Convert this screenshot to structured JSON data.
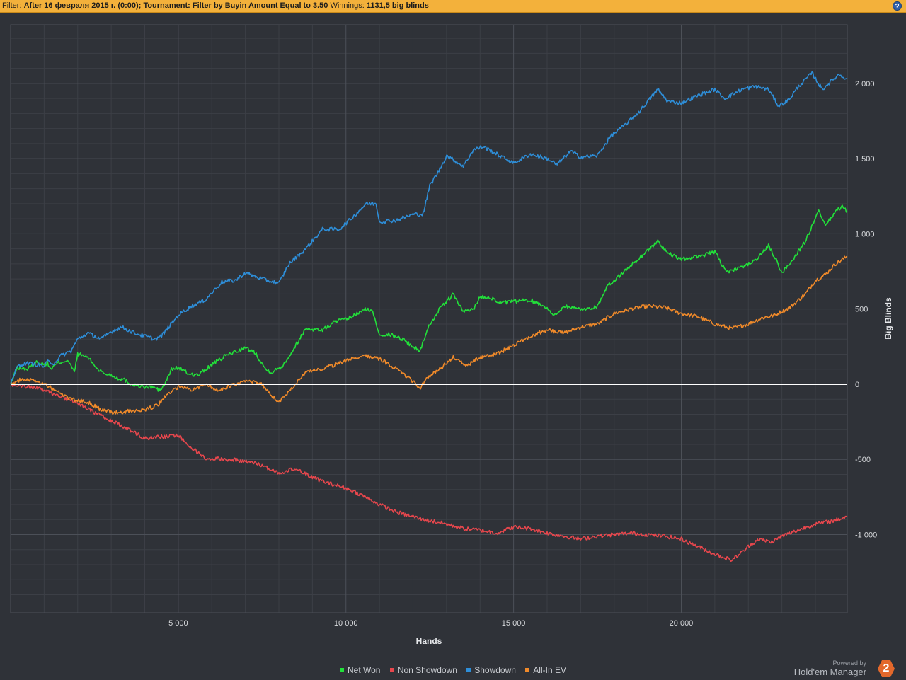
{
  "filter": {
    "label": "Filter:",
    "date_filter": "After 16 февраля 2015 г. (0:00);",
    "tournament_filter": "Tournament: Filter by Buyin Amount Equal to 3.50",
    "winnings_label": "Winnings:",
    "winnings_value": "1131,5 big blinds",
    "help_label": "?"
  },
  "brand": {
    "powered": "Powered by",
    "name": "Hold'em Manager",
    "logo_text": "2"
  },
  "colors": {
    "background": "#2f3238",
    "grid": "#4c5058",
    "zero_line": "#ffffff",
    "net_won": "#22e03a",
    "non_showdown": "#e8474d",
    "showdown": "#2e8ed8",
    "all_in_ev": "#f08a2a"
  },
  "chart_data": {
    "type": "line",
    "xlabel": "Hands",
    "ylabel": "Big Blinds",
    "xlim": [
      0,
      24950
    ],
    "ylim": [
      -1520,
      2390
    ],
    "x_ticks": [
      5000,
      10000,
      15000,
      20000
    ],
    "x_tick_labels": [
      "5 000",
      "10 000",
      "15 000",
      "20 000"
    ],
    "y_ticks": [
      2000,
      1500,
      1000,
      500,
      0,
      -500,
      -1000
    ],
    "y_tick_labels": [
      "2 000",
      "1 500",
      "1 000",
      "500",
      "0",
      "-500",
      "-1 000"
    ],
    "grid": true,
    "legend_position": "bottom",
    "series": [
      {
        "name": "Net Won",
        "color_key": "net_won",
        "points": [
          [
            0,
            0
          ],
          [
            200,
            110
          ],
          [
            500,
            100
          ],
          [
            800,
            150
          ],
          [
            1000,
            130
          ],
          [
            1100,
            140
          ],
          [
            1200,
            100
          ],
          [
            1400,
            140
          ],
          [
            1700,
            160
          ],
          [
            1900,
            80
          ],
          [
            2000,
            200
          ],
          [
            2300,
            180
          ],
          [
            2600,
            100
          ],
          [
            2800,
            70
          ],
          [
            3000,
            60
          ],
          [
            3200,
            40
          ],
          [
            3400,
            30
          ],
          [
            3600,
            0
          ],
          [
            3800,
            -10
          ],
          [
            4000,
            -20
          ],
          [
            4300,
            -20
          ],
          [
            4400,
            -40
          ],
          [
            4500,
            -30
          ],
          [
            4600,
            0
          ],
          [
            4800,
            100
          ],
          [
            5000,
            110
          ],
          [
            5300,
            70
          ],
          [
            5600,
            60
          ],
          [
            6000,
            130
          ],
          [
            6500,
            200
          ],
          [
            7000,
            240
          ],
          [
            7300,
            210
          ],
          [
            7600,
            100
          ],
          [
            7800,
            80
          ],
          [
            8100,
            120
          ],
          [
            8400,
            220
          ],
          [
            8800,
            370
          ],
          [
            9300,
            360
          ],
          [
            9700,
            420
          ],
          [
            10000,
            430
          ],
          [
            10600,
            500
          ],
          [
            10800,
            480
          ],
          [
            11000,
            330
          ],
          [
            11300,
            330
          ],
          [
            11700,
            300
          ],
          [
            12000,
            250
          ],
          [
            12200,
            220
          ],
          [
            12500,
            400
          ],
          [
            12800,
            500
          ],
          [
            13200,
            600
          ],
          [
            13500,
            480
          ],
          [
            13800,
            500
          ],
          [
            14000,
            580
          ],
          [
            14300,
            580
          ],
          [
            14600,
            540
          ],
          [
            15000,
            550
          ],
          [
            15500,
            560
          ],
          [
            16000,
            510
          ],
          [
            16200,
            450
          ],
          [
            16500,
            520
          ],
          [
            17000,
            500
          ],
          [
            17200,
            500
          ],
          [
            17500,
            520
          ],
          [
            17800,
            650
          ],
          [
            18300,
            750
          ],
          [
            18800,
            850
          ],
          [
            19300,
            950
          ],
          [
            19600,
            870
          ],
          [
            20000,
            830
          ],
          [
            20500,
            850
          ],
          [
            21000,
            880
          ],
          [
            21200,
            800
          ],
          [
            21400,
            740
          ],
          [
            21800,
            780
          ],
          [
            22200,
            820
          ],
          [
            22600,
            920
          ],
          [
            22800,
            840
          ],
          [
            23000,
            740
          ],
          [
            23300,
            820
          ],
          [
            23700,
            950
          ],
          [
            24000,
            1100
          ],
          [
            24100,
            1150
          ],
          [
            24300,
            1050
          ],
          [
            24600,
            1150
          ],
          [
            24800,
            1180
          ],
          [
            24950,
            1150
          ]
        ]
      },
      {
        "name": "Non Showdown",
        "color_key": "non_showdown",
        "points": [
          [
            0,
            0
          ],
          [
            300,
            -10
          ],
          [
            700,
            -20
          ],
          [
            1000,
            -40
          ],
          [
            1300,
            -70
          ],
          [
            1700,
            -100
          ],
          [
            2000,
            -130
          ],
          [
            2500,
            -190
          ],
          [
            3000,
            -240
          ],
          [
            3500,
            -300
          ],
          [
            4000,
            -360
          ],
          [
            4500,
            -350
          ],
          [
            5000,
            -340
          ],
          [
            5500,
            -440
          ],
          [
            5800,
            -490
          ],
          [
            6500,
            -500
          ],
          [
            7000,
            -510
          ],
          [
            7500,
            -540
          ],
          [
            8000,
            -590
          ],
          [
            8500,
            -560
          ],
          [
            9000,
            -620
          ],
          [
            9500,
            -660
          ],
          [
            10000,
            -690
          ],
          [
            10500,
            -740
          ],
          [
            11000,
            -800
          ],
          [
            11500,
            -850
          ],
          [
            12000,
            -880
          ],
          [
            12300,
            -900
          ],
          [
            12800,
            -920
          ],
          [
            13500,
            -960
          ],
          [
            14000,
            -970
          ],
          [
            14500,
            -990
          ],
          [
            15000,
            -950
          ],
          [
            15500,
            -960
          ],
          [
            16000,
            -990
          ],
          [
            16500,
            -1010
          ],
          [
            17000,
            -1030
          ],
          [
            17500,
            -1010
          ],
          [
            18000,
            -1000
          ],
          [
            18500,
            -990
          ],
          [
            19000,
            -1000
          ],
          [
            19500,
            -1010
          ],
          [
            20000,
            -1030
          ],
          [
            20500,
            -1080
          ],
          [
            21000,
            -1130
          ],
          [
            21500,
            -1170
          ],
          [
            21800,
            -1120
          ],
          [
            22000,
            -1080
          ],
          [
            22300,
            -1030
          ],
          [
            22700,
            -1050
          ],
          [
            23000,
            -1010
          ],
          [
            23500,
            -970
          ],
          [
            24000,
            -930
          ],
          [
            24500,
            -910
          ],
          [
            24950,
            -880
          ]
        ]
      },
      {
        "name": "Showdown",
        "color_key": "showdown",
        "points": [
          [
            0,
            0
          ],
          [
            200,
            120
          ],
          [
            500,
            140
          ],
          [
            800,
            130
          ],
          [
            1000,
            120
          ],
          [
            1100,
            150
          ],
          [
            1300,
            140
          ],
          [
            1500,
            190
          ],
          [
            1800,
            220
          ],
          [
            2000,
            300
          ],
          [
            2300,
            340
          ],
          [
            2700,
            300
          ],
          [
            3000,
            350
          ],
          [
            3300,
            380
          ],
          [
            3700,
            340
          ],
          [
            4000,
            320
          ],
          [
            4300,
            300
          ],
          [
            4500,
            320
          ],
          [
            5000,
            460
          ],
          [
            5400,
            520
          ],
          [
            5800,
            560
          ],
          [
            6300,
            680
          ],
          [
            6700,
            690
          ],
          [
            7000,
            740
          ],
          [
            7500,
            700
          ],
          [
            8000,
            670
          ],
          [
            8300,
            800
          ],
          [
            8800,
            900
          ],
          [
            9300,
            1030
          ],
          [
            9800,
            1030
          ],
          [
            10200,
            1110
          ],
          [
            10600,
            1200
          ],
          [
            10900,
            1200
          ],
          [
            11000,
            1080
          ],
          [
            11500,
            1090
          ],
          [
            12000,
            1130
          ],
          [
            12300,
            1130
          ],
          [
            12500,
            1320
          ],
          [
            12800,
            1430
          ],
          [
            13000,
            1520
          ],
          [
            13500,
            1450
          ],
          [
            13800,
            1560
          ],
          [
            14100,
            1580
          ],
          [
            14500,
            1530
          ],
          [
            15000,
            1470
          ],
          [
            15500,
            1530
          ],
          [
            16000,
            1500
          ],
          [
            16300,
            1460
          ],
          [
            16700,
            1550
          ],
          [
            17000,
            1510
          ],
          [
            17500,
            1520
          ],
          [
            17900,
            1650
          ],
          [
            18300,
            1720
          ],
          [
            18700,
            1800
          ],
          [
            19300,
            1960
          ],
          [
            19600,
            1880
          ],
          [
            20000,
            1870
          ],
          [
            20500,
            1920
          ],
          [
            21000,
            1960
          ],
          [
            21300,
            1900
          ],
          [
            21800,
            1960
          ],
          [
            22200,
            1980
          ],
          [
            22600,
            1960
          ],
          [
            22900,
            1850
          ],
          [
            23200,
            1890
          ],
          [
            23500,
            1980
          ],
          [
            23900,
            2070
          ],
          [
            24200,
            1960
          ],
          [
            24500,
            2020
          ],
          [
            24700,
            2060
          ],
          [
            24950,
            2030
          ]
        ]
      },
      {
        "name": "All-In EV",
        "color_key": "all_in_ev",
        "points": [
          [
            0,
            0
          ],
          [
            300,
            30
          ],
          [
            600,
            30
          ],
          [
            1000,
            0
          ],
          [
            1400,
            -50
          ],
          [
            1800,
            -100
          ],
          [
            2300,
            -120
          ],
          [
            2700,
            -170
          ],
          [
            3100,
            -190
          ],
          [
            3500,
            -180
          ],
          [
            4000,
            -170
          ],
          [
            4400,
            -140
          ],
          [
            4700,
            -60
          ],
          [
            5000,
            -20
          ],
          [
            5400,
            -40
          ],
          [
            5800,
            0
          ],
          [
            6200,
            -40
          ],
          [
            6700,
            0
          ],
          [
            7100,
            20
          ],
          [
            7500,
            0
          ],
          [
            7800,
            -80
          ],
          [
            8000,
            -120
          ],
          [
            8400,
            -20
          ],
          [
            8800,
            80
          ],
          [
            9300,
            100
          ],
          [
            9800,
            140
          ],
          [
            10200,
            170
          ],
          [
            10600,
            190
          ],
          [
            11000,
            170
          ],
          [
            11500,
            100
          ],
          [
            12000,
            20
          ],
          [
            12200,
            -30
          ],
          [
            12400,
            40
          ],
          [
            12800,
            100
          ],
          [
            13200,
            180
          ],
          [
            13600,
            120
          ],
          [
            14000,
            180
          ],
          [
            14500,
            200
          ],
          [
            15000,
            260
          ],
          [
            15500,
            320
          ],
          [
            16000,
            360
          ],
          [
            16500,
            340
          ],
          [
            17000,
            380
          ],
          [
            17500,
            400
          ],
          [
            18000,
            470
          ],
          [
            18500,
            500
          ],
          [
            19000,
            520
          ],
          [
            19500,
            510
          ],
          [
            20000,
            470
          ],
          [
            20500,
            450
          ],
          [
            21000,
            400
          ],
          [
            21500,
            370
          ],
          [
            22000,
            400
          ],
          [
            22400,
            440
          ],
          [
            22800,
            460
          ],
          [
            23300,
            520
          ],
          [
            23700,
            600
          ],
          [
            24000,
            690
          ],
          [
            24300,
            730
          ],
          [
            24600,
            800
          ],
          [
            24950,
            850
          ]
        ]
      }
    ]
  }
}
